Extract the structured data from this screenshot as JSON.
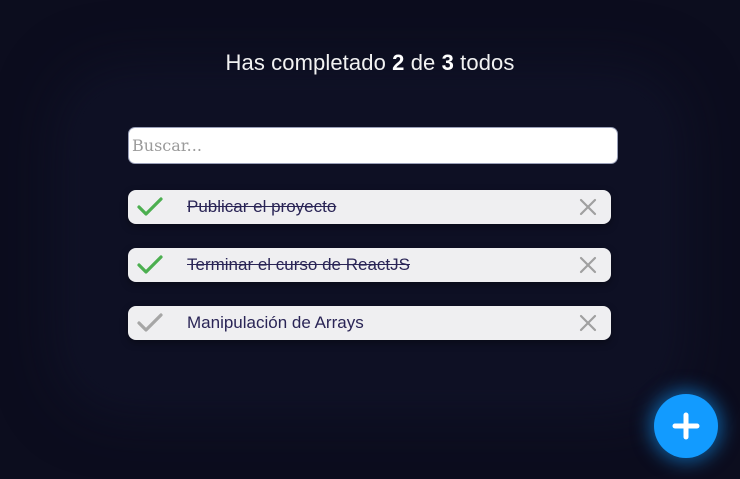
{
  "counter": {
    "prefix": "Has completado",
    "completed": "2",
    "middle": "de",
    "total": "3",
    "suffix": "todos"
  },
  "search": {
    "placeholder": "Buscar...",
    "value": ""
  },
  "todos": [
    {
      "text": "Publicar el proyecto",
      "completed": true
    },
    {
      "text": "Terminar el curso de ReactJS",
      "completed": true
    },
    {
      "text": "Manipulación de Arrays",
      "completed": false
    }
  ],
  "colors": {
    "background": "#0c0d1e",
    "check_completed": "#4caf50",
    "check_pending": "#a6a6a6",
    "delete_icon": "#a0a0a0",
    "fab": "#129bff"
  },
  "icons": {
    "check": "check-icon",
    "delete": "close-icon",
    "fab": "plus-icon"
  }
}
